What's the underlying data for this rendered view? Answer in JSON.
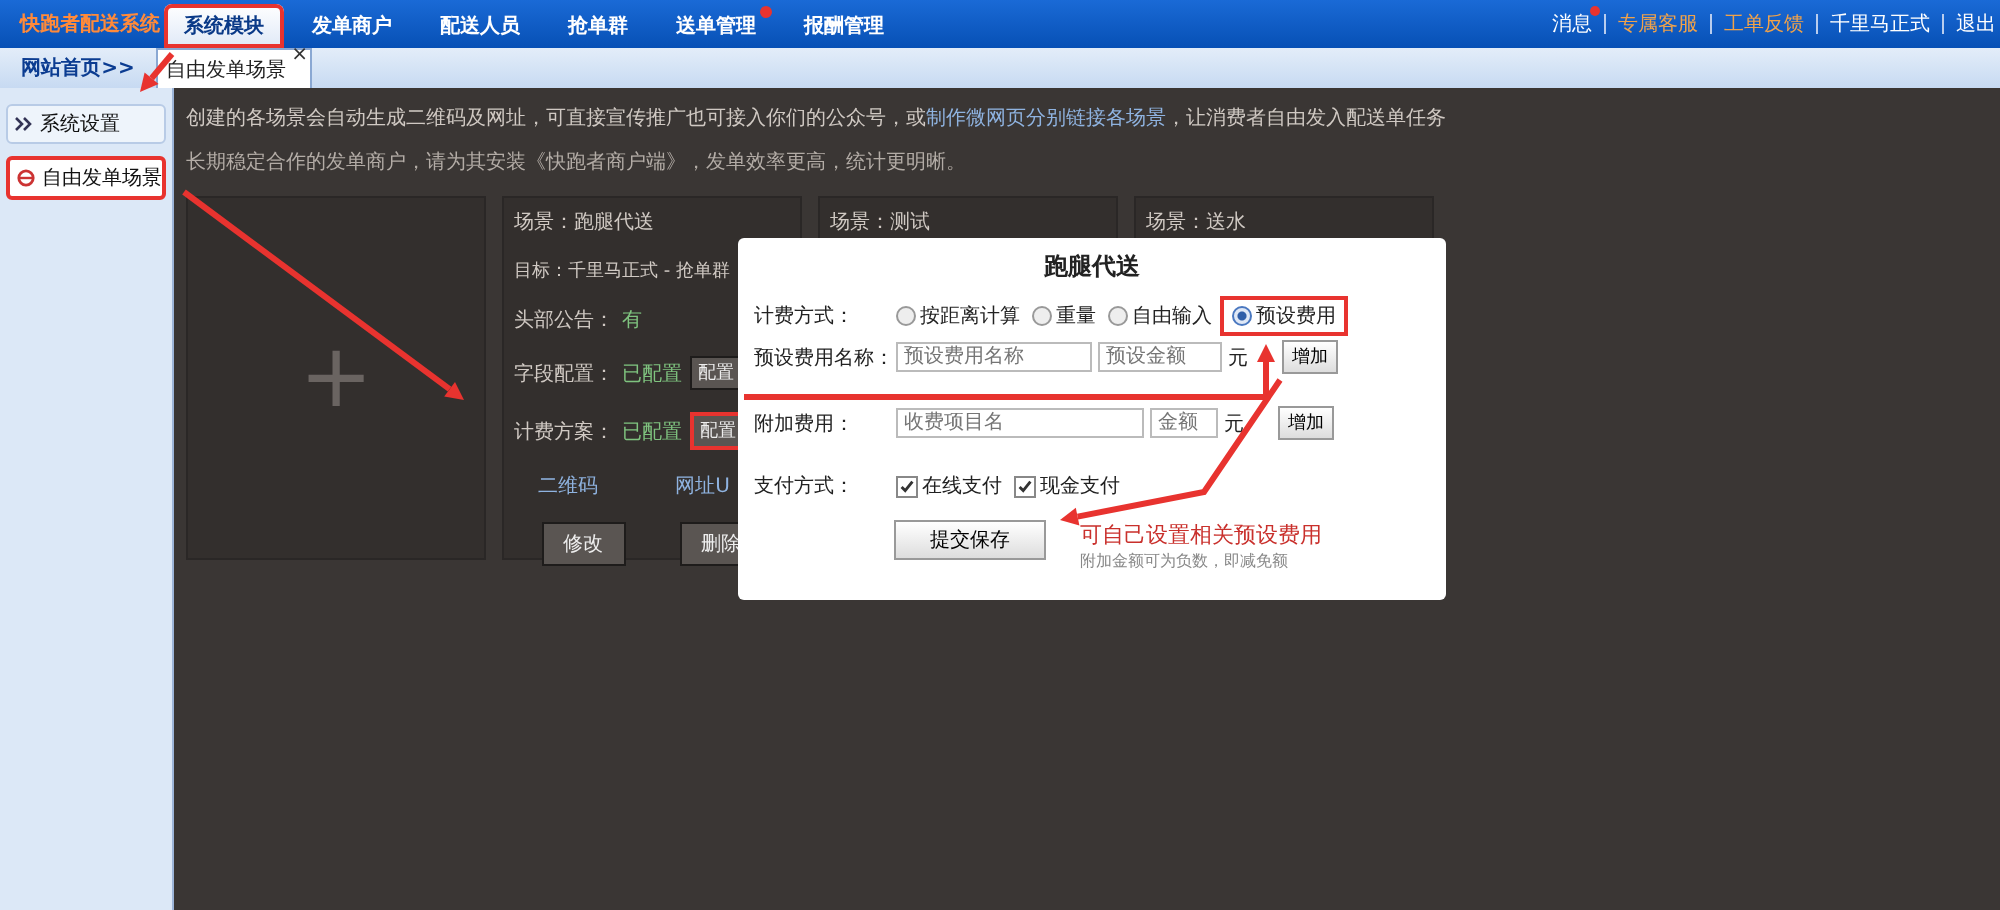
{
  "top_bar": {
    "logo": "快跑者配送系统",
    "nav": [
      {
        "label": "系统模块",
        "selected": true,
        "badge": false,
        "highlighted": true
      },
      {
        "label": "发单商户",
        "selected": false,
        "badge": false,
        "highlighted": false
      },
      {
        "label": "配送人员",
        "selected": false,
        "badge": false,
        "highlighted": false
      },
      {
        "label": "抢单群",
        "selected": false,
        "badge": false,
        "highlighted": false
      },
      {
        "label": "送单管理",
        "selected": false,
        "badge": true,
        "highlighted": false
      },
      {
        "label": "报酬管理",
        "selected": false,
        "badge": false,
        "highlighted": false
      }
    ],
    "links": [
      {
        "label": "消息",
        "kind": "plain",
        "badge": true
      },
      {
        "label": "专属客服",
        "kind": "highlight",
        "badge": false
      },
      {
        "label": "工单反馈",
        "kind": "highlight",
        "badge": false
      },
      {
        "label": "千里马正式",
        "kind": "plain",
        "badge": false
      },
      {
        "label": "退出",
        "kind": "plain",
        "badge": false
      }
    ]
  },
  "sub_bar": {
    "home_link": "网站首页>>",
    "tabs": [
      {
        "label": "自由发单场景",
        "close": "×",
        "selected": true
      }
    ]
  },
  "sidebar": {
    "items": [
      {
        "label": "系统设置",
        "kind": "group",
        "selected": false,
        "highlighted": false
      },
      {
        "label": "自由发单场景",
        "kind": "page",
        "selected": true,
        "highlighted": true
      }
    ]
  },
  "main": {
    "intro": {
      "before": "创建的各场景会自动生成二维码及网址，可直接宣传推广也可接入你们的公众号，或",
      "link": "制作微网页分别链接各场景",
      "after": "，让消费者自由发入配送单任务"
    },
    "note": "长期稳定合作的发单商户，请为其安装《快跑者商户端》，发单效率更高，统计更明晰。",
    "add_card": {
      "symbol": "+"
    },
    "cards": [
      {
        "scene": "场景：跑腿代送",
        "target": "目标：千里马正式 - 抢单群",
        "rows": [
          {
            "label": "头部公告：",
            "value": "有",
            "button": "",
            "highlighted": false
          },
          {
            "label": "字段配置：",
            "value": "已配置",
            "button": "配置",
            "highlighted": false
          },
          {
            "label": "计费方案：",
            "value": "已配置",
            "button": "配置",
            "highlighted": true
          }
        ],
        "links": [
          "二维码",
          "网址U"
        ],
        "actions": [
          "修改",
          "删除"
        ]
      },
      {
        "scene": "场景：测试"
      },
      {
        "scene": "场景：送水"
      }
    ]
  },
  "dialog": {
    "title": "跑腿代送",
    "billing": {
      "label": "计费方式：",
      "options": [
        {
          "label": "按距离计算",
          "selected": false,
          "highlighted": false
        },
        {
          "label": "重量",
          "selected": false,
          "highlighted": false
        },
        {
          "label": "自由输入",
          "selected": false,
          "highlighted": false
        },
        {
          "label": "预设费用",
          "selected": true,
          "highlighted": true
        }
      ]
    },
    "preset": {
      "label": "预设费用名称：",
      "name_placeholder": "预设费用名称",
      "amount_placeholder": "预设金额",
      "unit": "元",
      "button": "增加"
    },
    "extra": {
      "label": "附加费用：",
      "name_placeholder": "收费项目名",
      "amount_placeholder": "金额",
      "unit": "元",
      "button": "增加"
    },
    "payment": {
      "label": "支付方式：",
      "options": [
        {
          "label": "在线支付",
          "checked": true
        },
        {
          "label": "现金支付",
          "checked": true
        }
      ]
    },
    "submit": "提交保存",
    "hint": "附加金额可为负数，即减免额"
  },
  "annotation": {
    "text": "可自己设置相关预设费用"
  }
}
